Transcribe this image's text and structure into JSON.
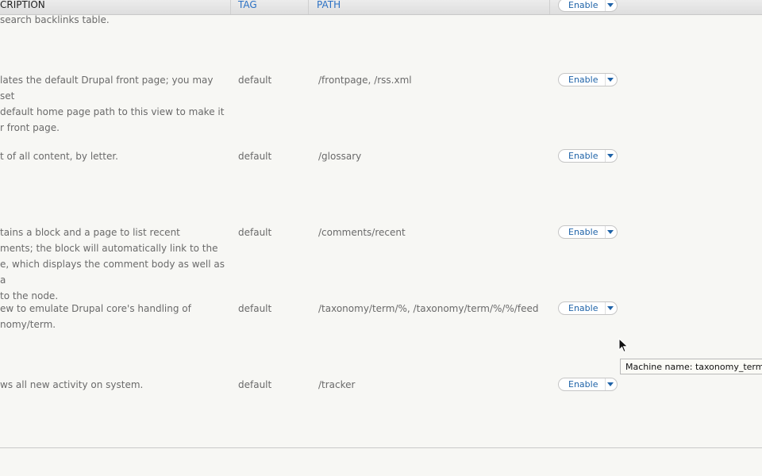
{
  "header": {
    "description": "CRIPTION",
    "tag": "TAG",
    "path": "PATH"
  },
  "rows": [
    {
      "description": "search backlinks table.",
      "tag": "",
      "path": "",
      "operation": ""
    },
    {
      "description": "lates the default Drupal front page; you may set\ndefault home page path to this view to make it\nr front page.",
      "tag": "default",
      "path": "/frontpage, /rss.xml",
      "operation": "Enable"
    },
    {
      "description": "t of all content, by letter.",
      "tag": "default",
      "path": "/glossary",
      "operation": "Enable"
    },
    {
      "description": "tains a block and a page to list recent\nments; the block will automatically link to the\ne, which displays the comment body as well as a\nto the node.",
      "tag": "default",
      "path": "/comments/recent",
      "operation": "Enable"
    },
    {
      "description": "ew to emulate Drupal core's handling of\nnomy/term.",
      "tag": "default",
      "path": "/taxonomy/term/%, /taxonomy/term/%/%/feed",
      "operation": "Enable"
    },
    {
      "description": "ws all new activity on system.",
      "tag": "default",
      "path": "/tracker",
      "operation": "Enable"
    }
  ],
  "header_operation": "Enable",
  "tooltip": "Machine name: taxonomy_term",
  "colors": {
    "link": "#1f63a8",
    "header_link": "#2b71c4",
    "text": "#6a6a6a"
  }
}
